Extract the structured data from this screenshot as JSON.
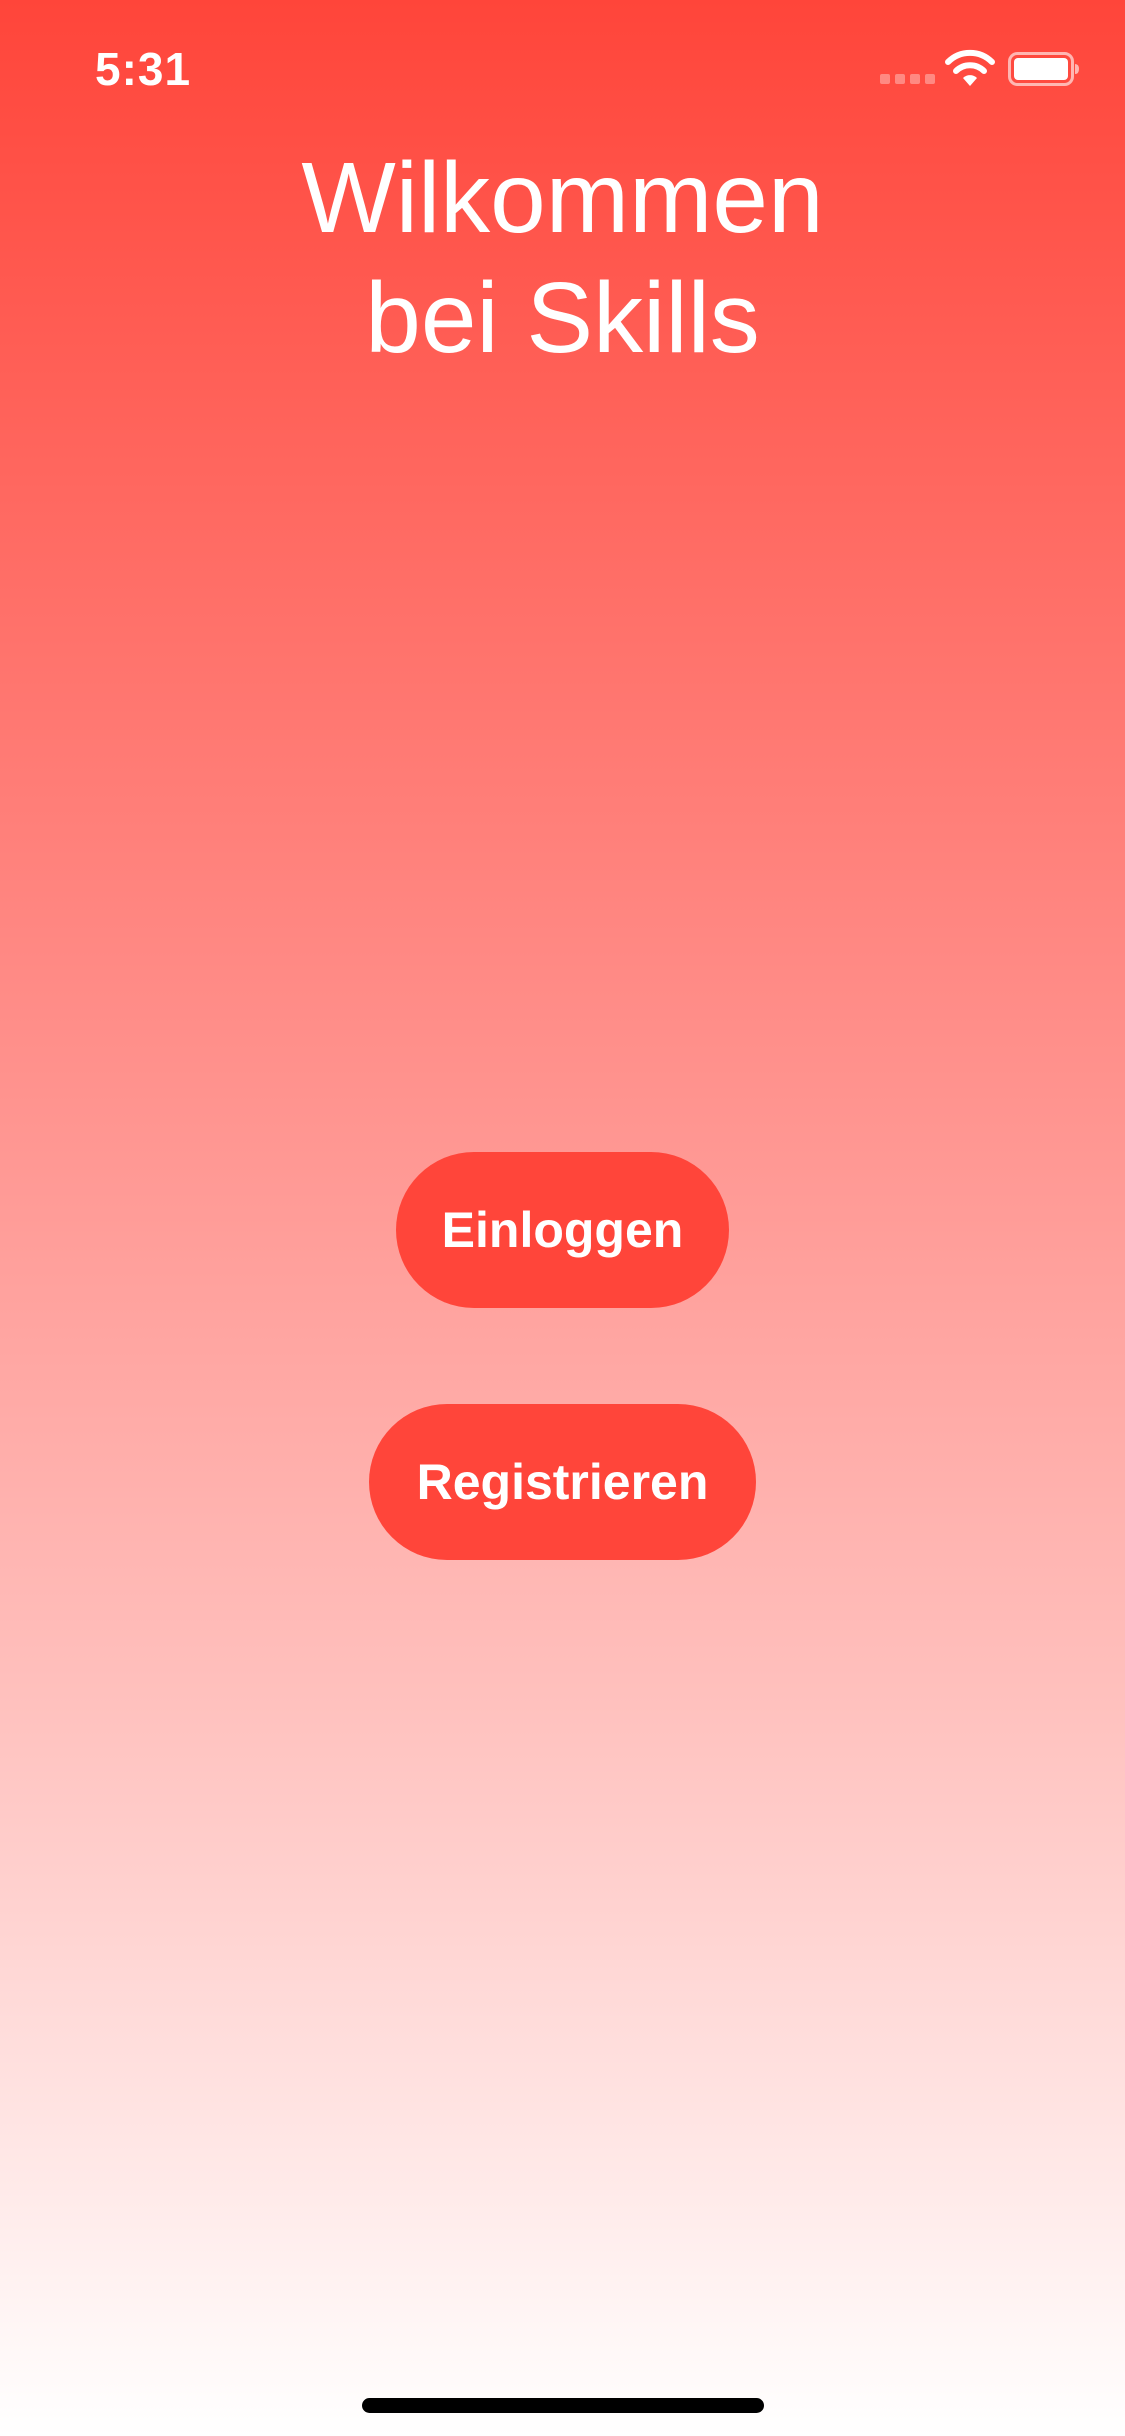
{
  "status_bar": {
    "time": "5:31",
    "icons": [
      "cellular-signal-icon",
      "wifi-icon",
      "battery-icon"
    ]
  },
  "welcome": {
    "title_line1": "Wilkommen",
    "title_line2": "bei Skills"
  },
  "buttons": {
    "login_label": "Einloggen",
    "register_label": "Registrieren"
  },
  "colors": {
    "accent": "#ff453a",
    "gradient_top": "#ff453a",
    "gradient_bottom": "#ffffff",
    "text_on_accent": "#ffffff"
  }
}
